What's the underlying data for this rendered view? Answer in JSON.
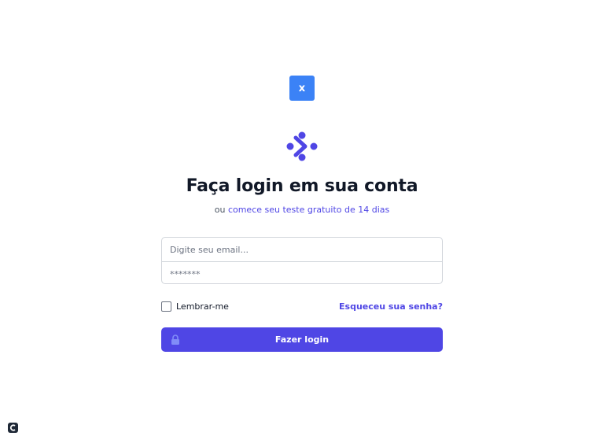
{
  "close_button": {
    "label": "x"
  },
  "logo": {
    "icon": "brand-logo-icon",
    "color": "#4f46e5"
  },
  "heading": {
    "title": "Faça login em sua conta"
  },
  "subtitle": {
    "prefix": "ou",
    "link": "comece seu teste gratuito de 14 dias"
  },
  "form": {
    "email_placeholder": "Digite seu email...",
    "password_placeholder": "*******"
  },
  "remember": {
    "label": "Lembrar-me",
    "checked": false
  },
  "forgot_link": "Esqueceu sua senha?",
  "login_button": {
    "label": "Fazer login",
    "icon": "lock-icon"
  },
  "colors": {
    "primary": "#4f46e5",
    "close_button": "#3b82f6",
    "text": "#111827"
  }
}
